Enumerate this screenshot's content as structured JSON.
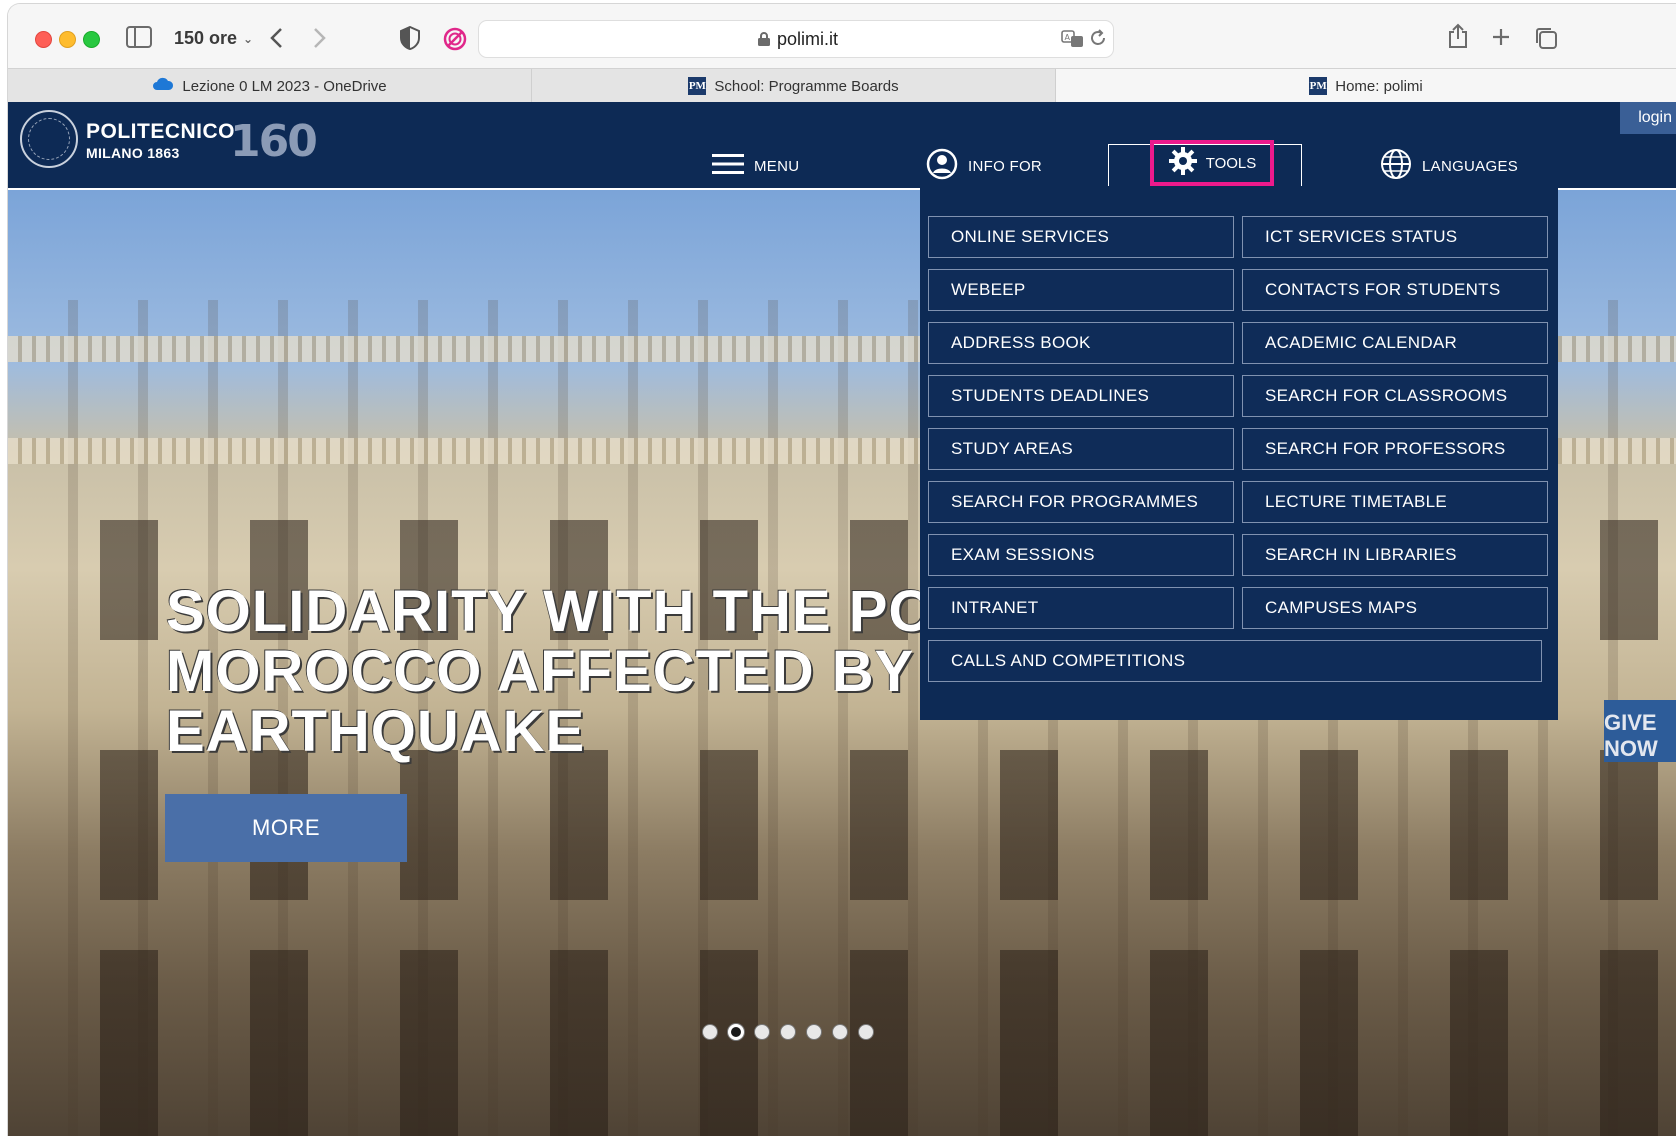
{
  "browser": {
    "tab_group": "150 ore",
    "url": "polimi.it",
    "tabs": [
      {
        "label": "Lezione 0 LM 2023 - OneDrive"
      },
      {
        "label": "School: Programme Boards"
      },
      {
        "label": "Home: polimi"
      }
    ]
  },
  "site": {
    "logo": {
      "name": "POLITECNICO",
      "sub": "MILANO 1863",
      "anniversary": "160"
    },
    "login": "login",
    "nav": {
      "menu": "MENU",
      "info_for": "INFO FOR",
      "tools": "TOOLS",
      "languages": "LANGUAGES"
    },
    "hero": {
      "title": "SOLIDARITY WITH THE PO\nMOROCCO AFFECTED BY T\nEARTHQUAKE",
      "more": "MORE",
      "slides": 7,
      "active_slide": 2,
      "side_banner": "GIVE NOW"
    },
    "tools_menu": [
      "ONLINE SERVICES",
      "ICT SERVICES STATUS",
      "WEBEEP",
      "CONTACTS FOR STUDENTS",
      "ADDRESS BOOK",
      "ACADEMIC CALENDAR",
      "STUDENTS DEADLINES",
      "SEARCH FOR CLASSROOMS",
      "STUDY AREAS",
      "SEARCH FOR PROFESSORS",
      "SEARCH FOR PROGRAMMES",
      "LECTURE TIMETABLE",
      "EXAM SESSIONS",
      "SEARCH IN LIBRARIES",
      "INTRANET",
      "CAMPUSES MAPS",
      "CALLS AND COMPETITIONS"
    ],
    "highlight_color": "#ec1a8c",
    "brand_color": "#0d2a55"
  }
}
